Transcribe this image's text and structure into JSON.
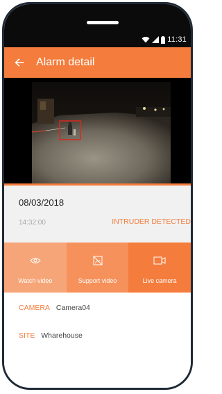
{
  "status_bar": {
    "time": "11:31",
    "icons": [
      "wifi-icon",
      "signal-icon",
      "battery-icon"
    ]
  },
  "app_bar": {
    "title": "Alarm detail",
    "back_icon": "back-arrow-icon"
  },
  "alarm": {
    "date": "08/03/2018",
    "time": "14:32:00",
    "status": "INTRUDER DETECTED"
  },
  "actions": [
    {
      "label": "Watch video",
      "icon": "eye-icon"
    },
    {
      "label": "Support video",
      "icon": "support-video-icon"
    },
    {
      "label": "Live camera",
      "icon": "video-camera-icon"
    }
  ],
  "details": {
    "camera_key": "CAMERA",
    "camera_value": "Camera04",
    "site_key": "SITE",
    "site_value": "Wharehouse"
  },
  "colors": {
    "accent": "#f47c3c",
    "status_bar": "#0b0b0b",
    "info_bg": "#f1f1f1"
  }
}
